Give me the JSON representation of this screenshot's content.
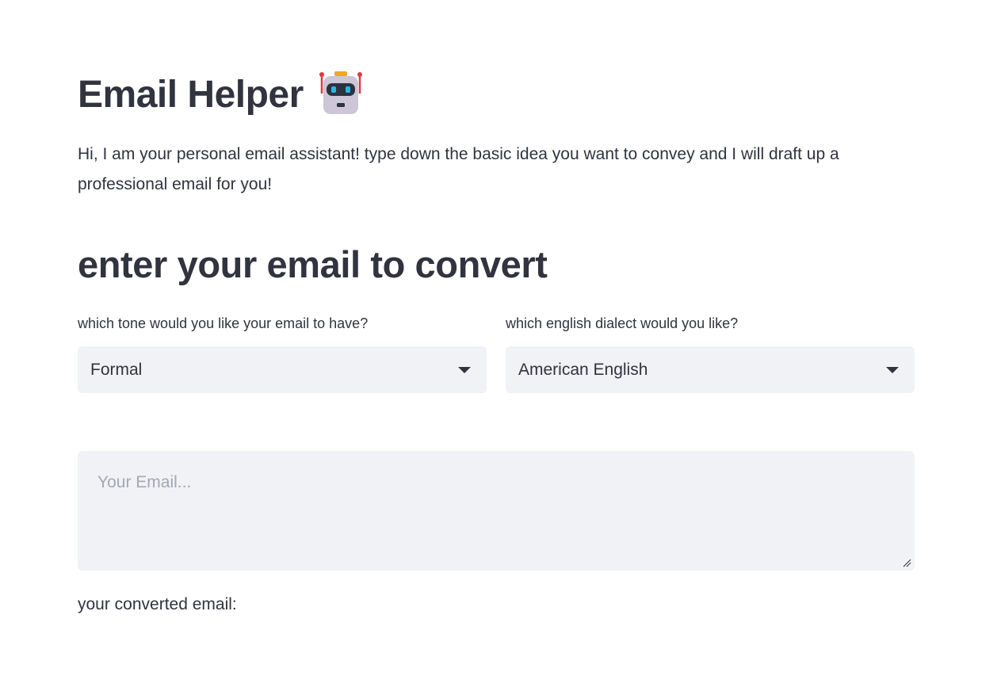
{
  "header": {
    "title": "Email Helper",
    "icon": "robot-icon"
  },
  "intro": {
    "text": "Hi, I am your personal email assistant! type down the basic idea you want to convey and I will draft up a professional email for you!"
  },
  "form": {
    "subheader": "enter your email to convert",
    "tone": {
      "label": "which tone would you like your email to have?",
      "selected": "Formal"
    },
    "dialect": {
      "label": "which english dialect would you like?",
      "selected": "American English"
    },
    "email_input": {
      "placeholder": "Your Email...",
      "value": ""
    }
  },
  "output": {
    "label": "your converted email:"
  },
  "colors": {
    "text": "#31333f",
    "input_bg": "#f0f2f6",
    "placeholder": "#a3a8b4"
  }
}
